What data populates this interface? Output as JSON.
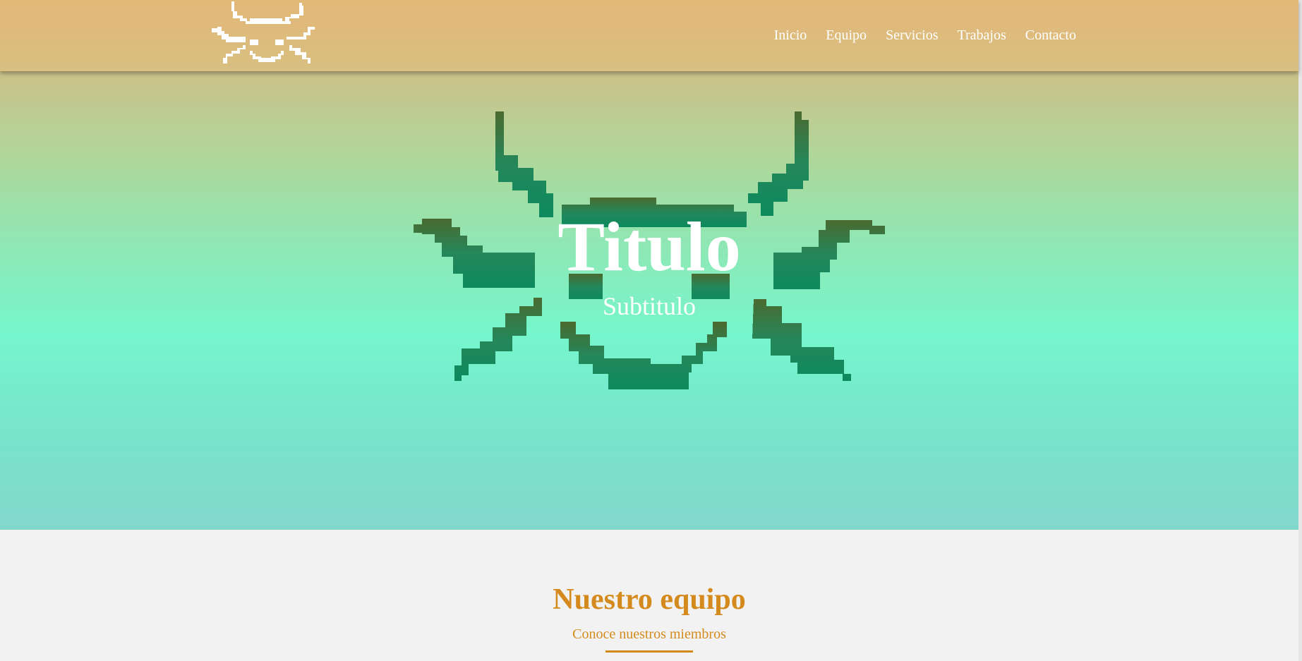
{
  "navbar": {
    "logo_name": "bug-logo",
    "links": [
      "Inicio",
      "Equipo",
      "Servicios",
      "Trabajos",
      "Contacto"
    ]
  },
  "hero": {
    "title": "Titulo",
    "subtitle": "Subtitulo",
    "emblem_name": "bug-emblem"
  },
  "team": {
    "title": "Nuestro equipo",
    "subtitle": "Conoce nuestros miembros"
  },
  "colors": {
    "accent": "#d48a1c",
    "nav_bg": "#e3b877",
    "hero_mint": "#76f6cc",
    "emblem_top": "#4a6a30",
    "emblem_bottom": "#0c8a5e",
    "page_bg": "#f2f2f2"
  }
}
